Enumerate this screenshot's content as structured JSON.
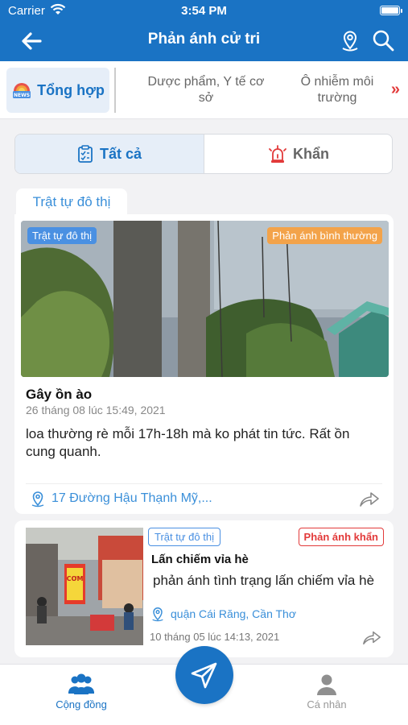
{
  "status_bar": {
    "carrier": "Carrier",
    "time": "3:54 PM"
  },
  "header": {
    "title": "Phản ánh cử tri",
    "icons": [
      "back-arrow-icon",
      "map-pin-icon",
      "search-icon"
    ]
  },
  "categories": {
    "items": [
      {
        "label": "Tổng hợp",
        "active": true,
        "icon": "news-icon"
      },
      {
        "label": "Dược phẩm, Y tế cơ sở",
        "active": false
      },
      {
        "label": "Ô nhiễm môi trường",
        "active": false
      }
    ],
    "more": "»"
  },
  "segment": {
    "items": [
      {
        "label": "Tất cả",
        "active": true,
        "icon": "clipboard-check-icon"
      },
      {
        "label": "Khẩn",
        "active": false,
        "icon": "alarm-light-icon"
      }
    ]
  },
  "section_tab": "Trật tự đô thị",
  "posts": [
    {
      "category_tag": "Trật tự đô thị",
      "status_tag": "Phản ánh bình thường",
      "title": "Gây ồn ào",
      "date": "26 tháng 08 lúc 15:49, 2021",
      "description": "loa thường rè mỗi 17h-18h mà ko phát tin tức. Rất ồn cung quanh.",
      "location": "17 Đường Hậu Thạnh Mỹ,..."
    },
    {
      "category_tag": "Trật tự đô thị",
      "status_tag": "Phản ánh khẩn",
      "title": "Lấn chiếm vỉa hè",
      "description": "phản ánh tình trạng lấn chiếm vỉa hè",
      "location": "quận Cái Răng, Cần Thơ",
      "date": "10 tháng 05 lúc 14:13, 2021",
      "thumb_sign_text": "CƠM"
    }
  ],
  "tab_bar": {
    "items": [
      {
        "label": "Cộng đồng",
        "active": true,
        "icon": "community-icon"
      },
      {
        "label": "Cá nhân",
        "active": false,
        "icon": "person-icon"
      }
    ],
    "fab_icon": "send-icon"
  },
  "colors": {
    "primary": "#1a73c4",
    "link": "#3a8fd9",
    "urgent": "#e23a3a",
    "normal_tag": "#f3a34a"
  }
}
